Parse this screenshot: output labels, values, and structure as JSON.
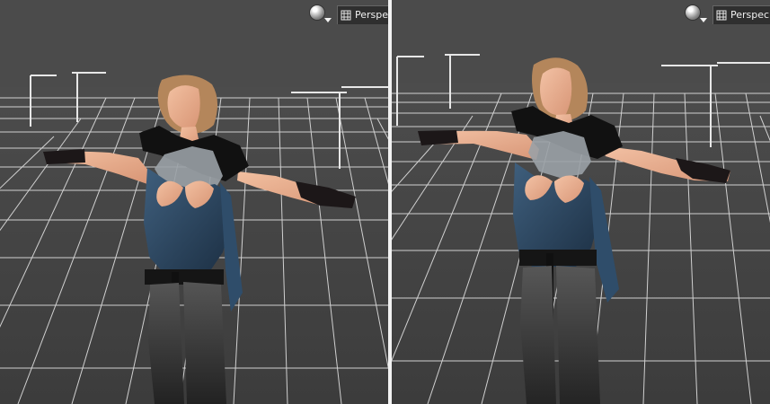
{
  "viewports": [
    {
      "id": "left",
      "camera_label": "Perspec",
      "shading_icon": "sphere-shading-icon",
      "camera_icon": "grid-camera-icon"
    },
    {
      "id": "right",
      "camera_label": "Perspec",
      "shading_icon": "sphere-shading-icon",
      "camera_icon": "grid-camera-icon"
    }
  ],
  "colors": {
    "viewport_bg": "#4a4a4a",
    "grid_line": "#d8d8d8",
    "toolbar_bg": "#2f2f2f",
    "divider": "#f2f2f2"
  }
}
